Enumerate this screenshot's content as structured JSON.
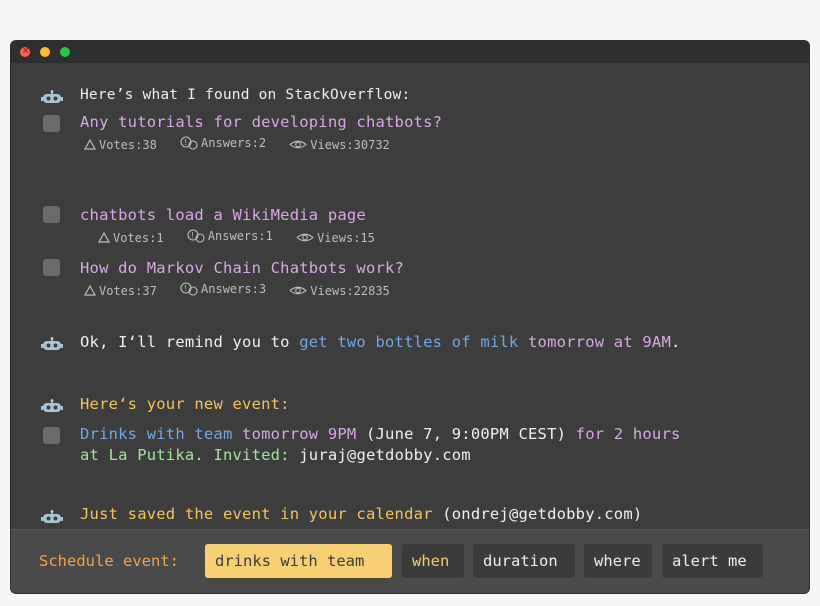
{
  "window": {
    "controls": [
      "close",
      "minimize",
      "maximize"
    ]
  },
  "messages": {
    "so_intro": "Here’s what I found on StackOverflow:",
    "so_results": [
      {
        "title": "Any tutorials for developing chatbots?",
        "votes": "Votes:38",
        "answers": "Answers:2",
        "views": "Views:30732"
      },
      {
        "title": "chatbots load a WikiMedia page",
        "votes": "Votes:1",
        "answers": "Answers:1",
        "views": "Views:15"
      },
      {
        "title": "How do Markov Chain Chatbots work?",
        "votes": "Votes:37",
        "answers": "Answers:3",
        "views": "Views:22835"
      }
    ],
    "remind": {
      "p1": "Ok, I‘ll remind you to ",
      "p2": "get two bottles of milk",
      "p3": " tomorrow at 9AM",
      "p4": "."
    },
    "event_intro": "Here‘s your new event:",
    "event": {
      "title": "Drinks with team",
      "when": " tomorrow 9PM",
      "date": " (June 7, 9:00PM CEST)",
      "duration": " for 2 hours",
      "location": "at La Putika.",
      "invited_label": " Invited:",
      "invited_email": " juraj@getdobby.com"
    },
    "saved": {
      "p1": "Just saved the event in your calendar",
      "p2": " (ondrej@getdobby.com)"
    }
  },
  "footer": {
    "label": "Schedule event:",
    "chips": [
      "drinks with team",
      "when",
      "duration",
      "where",
      "alert me"
    ]
  },
  "colors": {
    "purple": "#d9a8e6",
    "blue": "#74a6e6",
    "yellow": "#f4c45f",
    "green": "#a7e3a0",
    "chip_active": "#f9cf73"
  }
}
